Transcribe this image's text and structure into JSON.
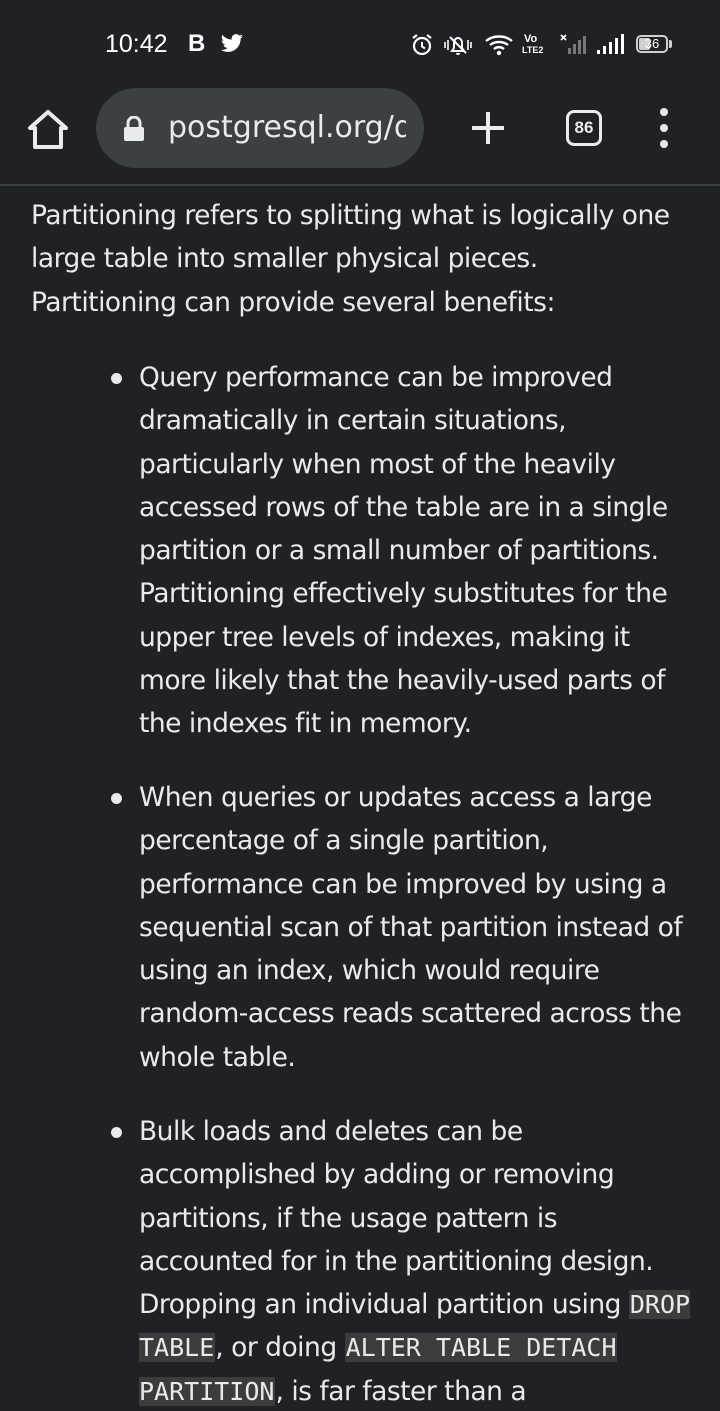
{
  "status_bar": {
    "time": "10:42",
    "b_label": "B",
    "twitter_icon": "twitter-icon",
    "alarm_icon": "alarm-icon",
    "mute_icon": "notifications-muted-icon",
    "wifi_icon": "wifi-icon",
    "volte_top": "Vo",
    "volte_bottom": "LTE2",
    "battery": "36"
  },
  "toolbar": {
    "home_icon": "home-icon",
    "lock_icon": "lock-icon",
    "url": "postgresql.org/docs",
    "new_tab_icon": "plus-icon",
    "tab_count": "86",
    "menu_icon": "more-vert-icon"
  },
  "content": {
    "intro": "Partitioning refers to splitting what is logically one large table into smaller physical pieces. Partitioning can provide several benefits:",
    "bullets": [
      {
        "text": "Query performance can be improved dramatically in certain situations, particularly when most of the heavily accessed rows of the table are in a single partition or a small number of partitions. Partitioning effectively substitutes for the upper tree levels of indexes, making it more likely that the heavily-used parts of the indexes fit in memory."
      },
      {
        "text": "When queries or updates access a large percentage of a single partition, performance can be improved by using a sequential scan of that partition instead of using an index, which would require random-access reads scattered across the whole table."
      },
      {
        "text_before": "Bulk loads and deletes can be accomplished by adding or removing partitions, if the usage pattern is accounted for in the partitioning design. Dropping an individual partition using ",
        "code1": "DROP TABLE",
        "text_middle": ", or doing ",
        "code2": "ALTER TABLE DETACH PARTITION",
        "text_after": ", is far faster than a"
      }
    ]
  },
  "colors": {
    "background": "#202124",
    "text": "#e8eaed",
    "url_pill": "#3c4043",
    "code_bg": "#3c3c3c"
  }
}
